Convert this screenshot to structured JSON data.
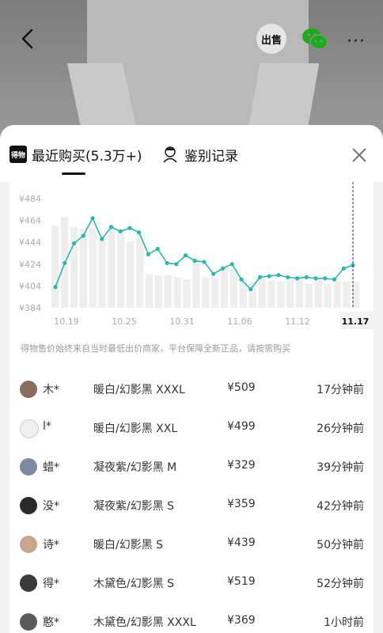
{
  "header": {
    "sell_badge": "出售",
    "more_icon": "···"
  },
  "tabs": [
    {
      "label": "最近购买(5.3万+)",
      "logo": "得物"
    },
    {
      "label": "鉴别记录"
    }
  ],
  "chart_data": {
    "type": "bar",
    "ylim": [
      384,
      484
    ],
    "y_ticks": [
      "¥484",
      "¥464",
      "¥444",
      "¥424",
      "¥404",
      "¥384"
    ],
    "x_ticks": [
      "10.19",
      "10.25",
      "10.31",
      "11.06",
      "11.12",
      "11.17"
    ],
    "highlight_label": "11.17",
    "bar_values": [
      459,
      467,
      458,
      456,
      457,
      447,
      457,
      455,
      445,
      452,
      415,
      414,
      414,
      412,
      410,
      430,
      412,
      412,
      423,
      420,
      410,
      408,
      411,
      409,
      408,
      410,
      414,
      406,
      411,
      406,
      409,
      408,
      408
    ],
    "series": [
      {
        "values": [
          403,
          425,
          443,
          450,
          466,
          447,
          458,
          454,
          457,
          453,
          433,
          438,
          425,
          424,
          432,
          427,
          426,
          415,
          420,
          424,
          410,
          401,
          412,
          413,
          414,
          412,
          411,
          412,
          411,
          411,
          410,
          420,
          423
        ]
      }
    ],
    "colors": {
      "line": "#2bb8a8",
      "bar": "#eeeeee"
    }
  },
  "note": "得物售价始终来自当时最低出价商家，平台保障全新正品，请按需购买",
  "purchases": [
    {
      "name": "木*",
      "spec": "暖白/幻影黑 XXXL",
      "price": "¥509",
      "time": "17分钟前",
      "avatar_color": "#8a6d5a"
    },
    {
      "name": "l*",
      "spec": "暖白/幻影黑 XXL",
      "price": "¥499",
      "time": "26分钟前",
      "avatar_color": "#f0f0f0"
    },
    {
      "name": "蜡*",
      "spec": "凝夜紫/幻影黑 M",
      "price": "¥329",
      "time": "39分钟前",
      "avatar_color": "#7a8aa0"
    },
    {
      "name": "没*",
      "spec": "凝夜紫/幻影黑 S",
      "price": "¥359",
      "time": "42分钟前",
      "avatar_color": "#2a2a2a"
    },
    {
      "name": "诗*",
      "spec": "暖白/幻影黑 S",
      "price": "¥439",
      "time": "50分钟前",
      "avatar_color": "#c9a58e"
    },
    {
      "name": "得*",
      "spec": "木黛色/幻影黑 S",
      "price": "¥519",
      "time": "52分钟前",
      "avatar_color": "#3a3a3a"
    },
    {
      "name": "憨*",
      "spec": "木黛色/幻影黑 XXXL",
      "price": "¥369",
      "time": "1小时前",
      "avatar_color": "#5a5a5a"
    }
  ]
}
